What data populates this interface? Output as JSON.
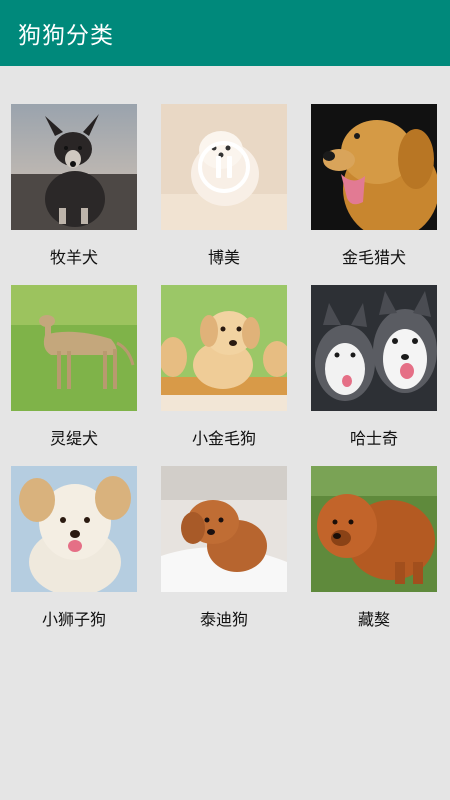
{
  "app": {
    "title": "狗狗分类"
  },
  "breeds": [
    {
      "name": "牧羊犬",
      "icon": "shepherd-dog-photo"
    },
    {
      "name": "博美",
      "icon": "pomeranian-photo"
    },
    {
      "name": "金毛猎犬",
      "icon": "golden-retriever-photo"
    },
    {
      "name": "灵缇犬",
      "icon": "greyhound-photo"
    },
    {
      "name": "小金毛狗",
      "icon": "golden-puppy-photo"
    },
    {
      "name": "哈士奇",
      "icon": "husky-photo"
    },
    {
      "name": "小狮子狗",
      "icon": "little-lion-dog-photo"
    },
    {
      "name": "泰迪狗",
      "icon": "teddy-dog-photo"
    },
    {
      "name": "藏獒",
      "icon": "tibetan-mastiff-photo"
    }
  ],
  "colors": {
    "app_bar": "#00897b",
    "background": "#e5e5e5"
  }
}
